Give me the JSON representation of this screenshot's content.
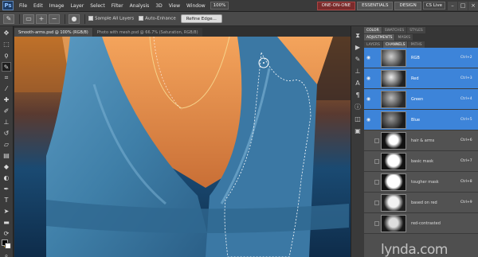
{
  "app": {
    "logo": "Ps",
    "menu": [
      "File",
      "Edit",
      "Image",
      "Layer",
      "Select",
      "Filter",
      "Analysis",
      "3D",
      "View",
      "Window"
    ],
    "zoom": "100%",
    "workspace_buttons": [
      "ONE-ON-ONE",
      "ESSENTIALS",
      "DESIGN"
    ],
    "cs_live": "CS Live"
  },
  "options": {
    "sample_all_layers": "Sample All Layers",
    "auto_enhance": "Auto-Enhance",
    "refine_edge": "Refine Edge..."
  },
  "document": {
    "tabs": [
      "Smooth-arms.psd @ 100% (RGB/8)",
      "Photo with mesh.psd @ 66.7% (Saturation, RGB/8)"
    ]
  },
  "panels": {
    "top_tabs": [
      "COLOR",
      "SWATCHES",
      "STYLES"
    ],
    "mid_tabs": [
      "ADJUSTMENTS",
      "MASKS"
    ],
    "layer_tabs": [
      "LAYERS",
      "CHANNELS",
      "PATHS"
    ],
    "channels": [
      {
        "name": "RGB",
        "shortcut": "Ctrl+2",
        "selected": true,
        "visible": true
      },
      {
        "name": "Red",
        "shortcut": "Ctrl+3",
        "selected": true,
        "visible": true
      },
      {
        "name": "Green",
        "shortcut": "Ctrl+4",
        "selected": true,
        "visible": true
      },
      {
        "name": "Blue",
        "shortcut": "Ctrl+5",
        "selected": true,
        "visible": true
      },
      {
        "name": "hair & arms",
        "shortcut": "Ctrl+6",
        "selected": false,
        "visible": false
      },
      {
        "name": "basic mask",
        "shortcut": "Ctrl+7",
        "selected": false,
        "visible": false
      },
      {
        "name": "tougher mask",
        "shortcut": "Ctrl+8",
        "selected": false,
        "visible": false
      },
      {
        "name": "based on red",
        "shortcut": "Ctrl+9",
        "selected": false,
        "visible": false
      },
      {
        "name": "red-contrasted",
        "shortcut": "",
        "selected": false,
        "visible": false
      }
    ]
  },
  "watermark": "lynda.com",
  "colors": {
    "selection_blue": "#3d84d9",
    "dress_blue": "#3f7fa8"
  }
}
